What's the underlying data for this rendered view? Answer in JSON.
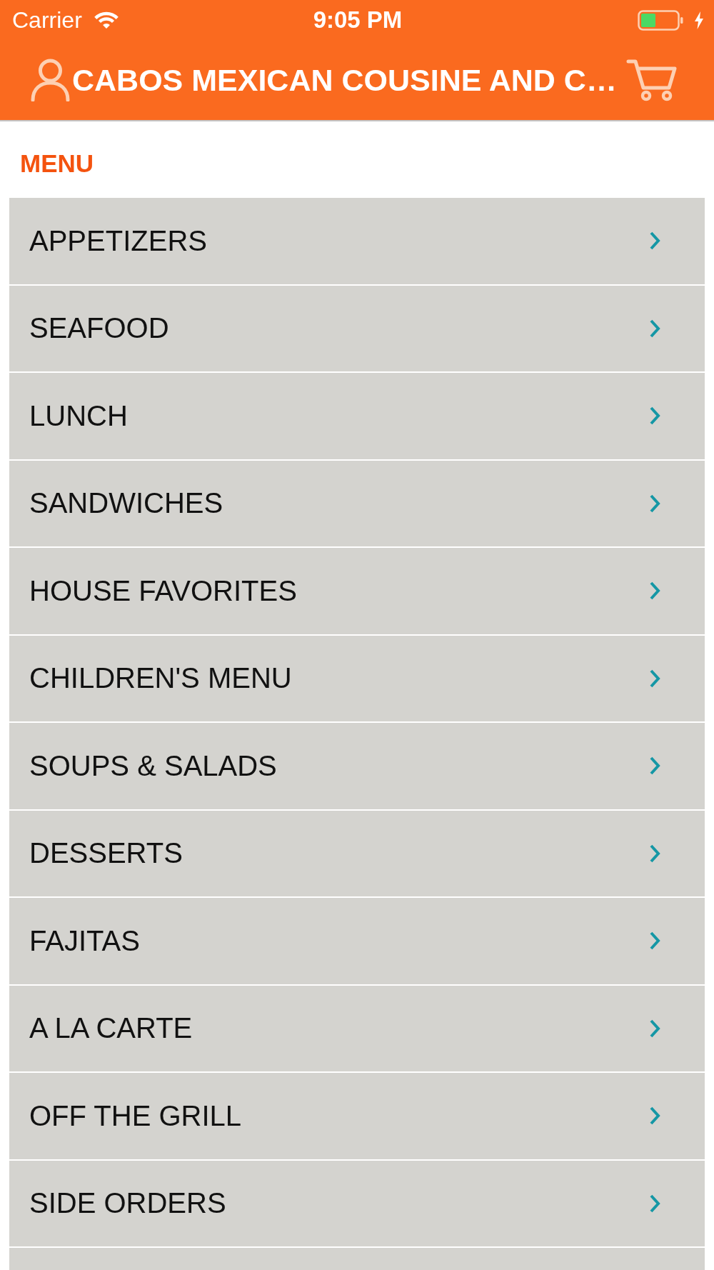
{
  "status_bar": {
    "carrier": "Carrier",
    "time": "9:05 PM"
  },
  "header": {
    "title": "CABOS MEXICAN COUSINE AND C…"
  },
  "menu": {
    "heading": "MENU",
    "categories": [
      "APPETIZERS",
      "SEAFOOD",
      "LUNCH",
      "SANDWICHES",
      "HOUSE FAVORITES",
      "CHILDREN'S MENU",
      "SOUPS & SALADS",
      "DESSERTS",
      "FAJITAS",
      "A LA CARTE",
      "OFF THE GRILL",
      "SIDE ORDERS"
    ],
    "more_below": true
  }
}
